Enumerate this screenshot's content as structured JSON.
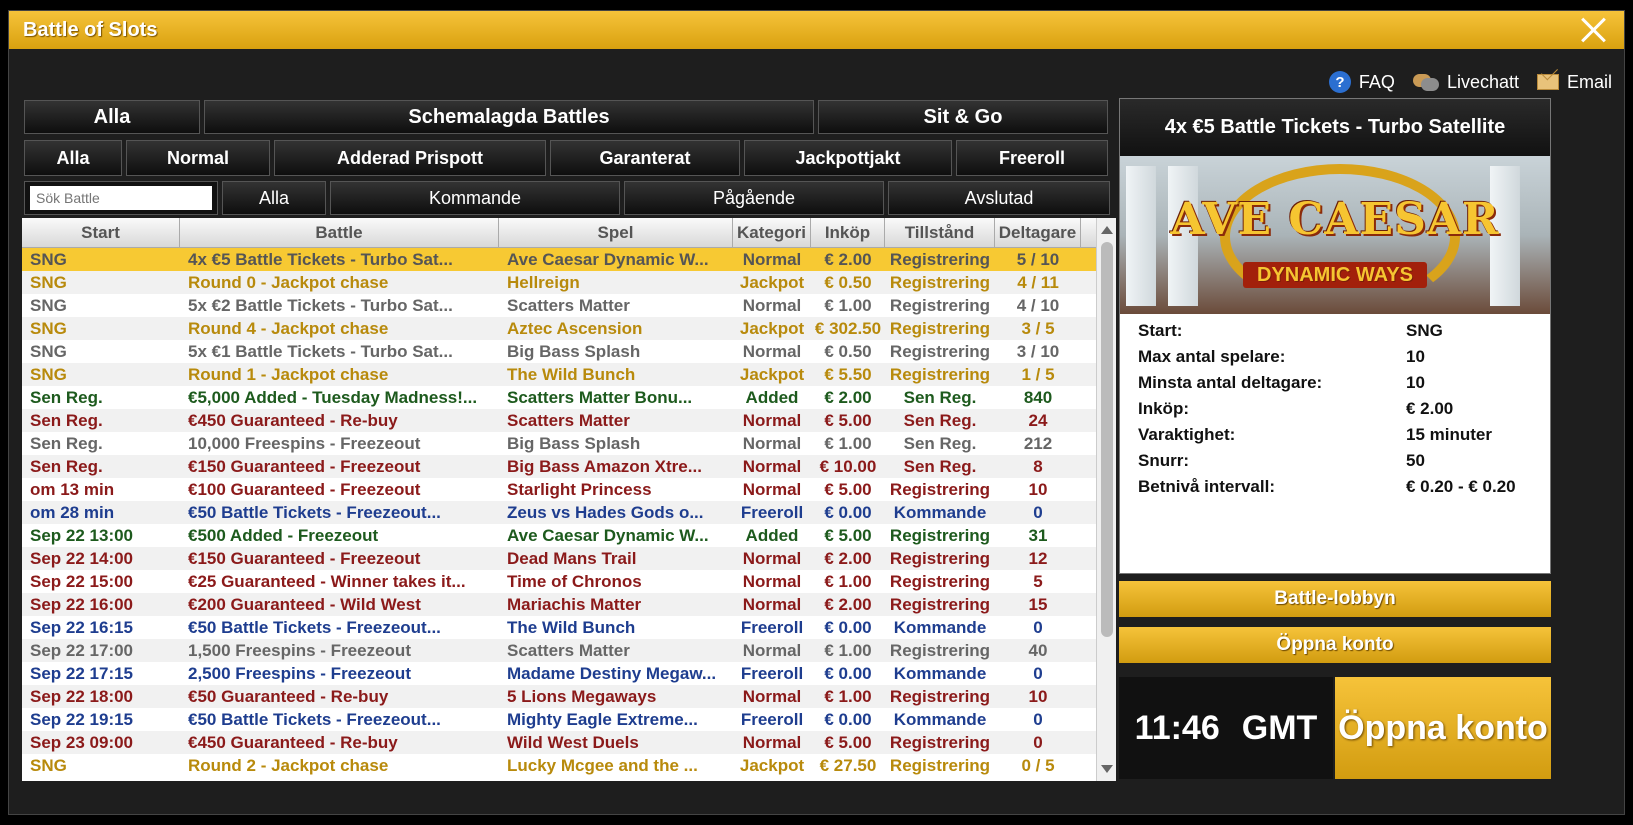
{
  "window": {
    "title": "Battle of Slots"
  },
  "toplinks": {
    "faq": "FAQ",
    "livechat": "Livechatt",
    "email": "Email"
  },
  "row1": [
    "Alla",
    "Schemalagda Battles",
    "Sit & Go"
  ],
  "row2": [
    "Alla",
    "Normal",
    "Adderad Prispott",
    "Garanterat",
    "Jackpottjakt",
    "Freeroll"
  ],
  "search": {
    "placeholder": "Sök Battle"
  },
  "row3": [
    "Alla",
    "Kommande",
    "Pågående",
    "Avslutad"
  ],
  "table": {
    "headers": [
      "Start",
      "Battle",
      "Spel",
      "Kategori",
      "Inköp",
      "Tillstånd",
      "Deltagare"
    ],
    "rows": [
      {
        "c": [
          "SNG",
          "4x €5 Battle Tickets - Turbo Sat...",
          "Ave Caesar Dynamic W...",
          "Normal",
          "€ 2.00",
          "Registrering",
          "5 / 10"
        ],
        "color": "gray",
        "selected": true
      },
      {
        "c": [
          "SNG",
          "Round 0 - Jackpot chase",
          "Hellreign",
          "Jackpot",
          "€ 0.50",
          "Registrering",
          "4 / 11"
        ],
        "color": "gold"
      },
      {
        "c": [
          "SNG",
          "5x €2 Battle Tickets - Turbo Sat...",
          "Scatters Matter",
          "Normal",
          "€ 1.00",
          "Registrering",
          "4 / 10"
        ],
        "color": "gray"
      },
      {
        "c": [
          "SNG",
          "Round 4 - Jackpot chase",
          "Aztec Ascension",
          "Jackpot",
          "€ 302.50",
          "Registrering",
          "3 / 5"
        ],
        "color": "gold"
      },
      {
        "c": [
          "SNG",
          "5x €1 Battle Tickets - Turbo Sat...",
          "Big Bass Splash",
          "Normal",
          "€ 0.50",
          "Registrering",
          "3 / 10"
        ],
        "color": "gray"
      },
      {
        "c": [
          "SNG",
          "Round 1 - Jackpot chase",
          "The Wild Bunch",
          "Jackpot",
          "€ 5.50",
          "Registrering",
          "1 / 5"
        ],
        "color": "gold"
      },
      {
        "c": [
          "Sen Reg.",
          "€5,000 Added - Tuesday Madness!...",
          "Scatters Matter Bonu...",
          "Added",
          "€ 2.00",
          "Sen Reg.",
          "840"
        ],
        "color": "green"
      },
      {
        "c": [
          "Sen Reg.",
          "€450 Guaranteed - Re-buy",
          "Scatters Matter",
          "Normal",
          "€ 5.00",
          "Sen Reg.",
          "24"
        ],
        "color": "red"
      },
      {
        "c": [
          "Sen Reg.",
          "10,000 Freespins - Freezeout",
          "Big Bass Splash",
          "Normal",
          "€ 1.00",
          "Sen Reg.",
          "212"
        ],
        "color": "gray"
      },
      {
        "c": [
          "Sen Reg.",
          "€150 Guaranteed - Freezeout",
          "Big Bass Amazon Xtre...",
          "Normal",
          "€ 10.00",
          "Sen Reg.",
          "8"
        ],
        "color": "red"
      },
      {
        "c": [
          "om 13 min",
          "€100 Guaranteed - Freezeout",
          "Starlight Princess",
          "Normal",
          "€ 5.00",
          "Registrering",
          "10"
        ],
        "color": "red"
      },
      {
        "c": [
          "om 28 min",
          "€50 Battle Tickets - Freezeout...",
          "Zeus vs Hades Gods o...",
          "Freeroll",
          "€ 0.00",
          "Kommande",
          "0"
        ],
        "color": "blue"
      },
      {
        "c": [
          "Sep 22 13:00",
          "€500 Added - Freezeout",
          "Ave Caesar Dynamic W...",
          "Added",
          "€ 5.00",
          "Registrering",
          "31"
        ],
        "color": "green"
      },
      {
        "c": [
          "Sep 22 14:00",
          "€150 Guaranteed - Freezeout",
          "Dead Mans Trail",
          "Normal",
          "€ 2.00",
          "Registrering",
          "12"
        ],
        "color": "red"
      },
      {
        "c": [
          "Sep 22 15:00",
          "€25 Guaranteed - Winner takes it...",
          "Time of Chronos",
          "Normal",
          "€ 1.00",
          "Registrering",
          "5"
        ],
        "color": "red"
      },
      {
        "c": [
          "Sep 22 16:00",
          "€200 Guaranteed - Wild West",
          "Mariachis Matter",
          "Normal",
          "€ 2.00",
          "Registrering",
          "15"
        ],
        "color": "red"
      },
      {
        "c": [
          "Sep 22 16:15",
          "€50 Battle Tickets - Freezeout...",
          "The Wild Bunch",
          "Freeroll",
          "€ 0.00",
          "Kommande",
          "0"
        ],
        "color": "blue"
      },
      {
        "c": [
          "Sep 22 17:00",
          "1,500 Freespins - Freezeout",
          "Scatters Matter",
          "Normal",
          "€ 1.00",
          "Registrering",
          "40"
        ],
        "color": "gray"
      },
      {
        "c": [
          "Sep 22 17:15",
          "2,500 Freespins - Freezeout",
          "Madame Destiny Megaw...",
          "Freeroll",
          "€ 0.00",
          "Kommande",
          "0"
        ],
        "color": "blue"
      },
      {
        "c": [
          "Sep 22 18:00",
          "€50 Guaranteed - Re-buy",
          "5 Lions Megaways",
          "Normal",
          "€ 1.00",
          "Registrering",
          "10"
        ],
        "color": "red"
      },
      {
        "c": [
          "Sep 22 19:15",
          "€50 Battle Tickets - Freezeout...",
          "Mighty Eagle Extreme...",
          "Freeroll",
          "€ 0.00",
          "Kommande",
          "0"
        ],
        "color": "blue"
      },
      {
        "c": [
          "Sep 23 09:00",
          "€450 Guaranteed - Re-buy",
          "Wild West Duels",
          "Normal",
          "€ 5.00",
          "Registrering",
          "0"
        ],
        "color": "red"
      },
      {
        "c": [
          "SNG",
          "Round 2 - Jackpot chase",
          "Lucky Mcgee and the ...",
          "Jackpot",
          "€ 27.50",
          "Registrering",
          "0 / 5"
        ],
        "color": "gold"
      }
    ]
  },
  "colors": {
    "gray": "#666666",
    "gold": "#b88a0c",
    "green": "#1d5a1d",
    "red": "#8b1a1a",
    "blue": "#1e3d8f",
    "accent": "#f7c933"
  },
  "panel": {
    "title": "4x €5 Battle Tickets - Turbo Satellite",
    "banner_line1": "AVE CAESAR",
    "banner_line2": "DYNAMIC WAYS",
    "details": [
      {
        "label": "Start:",
        "value": "SNG"
      },
      {
        "label": "Max antal spelare:",
        "value": "10"
      },
      {
        "label": "Minsta antal deltagare:",
        "value": "10"
      },
      {
        "label": "Inköp:",
        "value": "€ 2.00"
      },
      {
        "label": "Varaktighet:",
        "value": "15 minuter"
      },
      {
        "label": "Snurr:",
        "value": "50"
      },
      {
        "label": "Betnivå intervall:",
        "value": "€ 0.20 - € 0.20"
      }
    ]
  },
  "buttons": {
    "lobby": "Battle-lobbyn",
    "open_account": "Öppna konto",
    "open_account_big": "Öppna konto"
  },
  "clock": {
    "time": "11:46",
    "zone": "GMT"
  }
}
